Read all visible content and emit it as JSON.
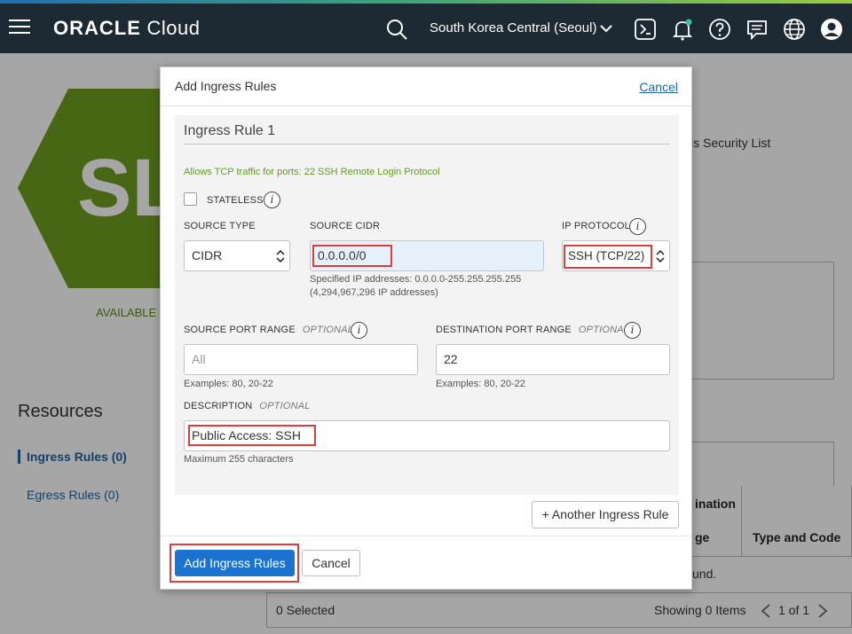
{
  "topbar": {
    "brand_bold": "ORACLE",
    "brand_light": "Cloud",
    "region": "South Korea Central (Seoul)",
    "icons": [
      "menu-icon",
      "search-icon",
      "chevron-down-icon",
      "cloud-shell-icon",
      "bell-icon",
      "help-icon",
      "chat-icon",
      "globe-icon",
      "user-icon"
    ],
    "accent_colors": [
      "#1f6fb4",
      "#3aa37c",
      "#9ccb3b"
    ]
  },
  "background": {
    "badge_text": "SL",
    "status": "AVAILABLE",
    "resources_title": "Resources",
    "resources_items": [
      {
        "label": "Ingress Rules (0)"
      },
      {
        "label": "Egress Rules (0)"
      }
    ],
    "partial_text_security_list": "is Security List",
    "table_headers": [
      "ination",
      "ge",
      "Type and Code"
    ],
    "partial_text_found": "und.",
    "selected": "0 Selected",
    "showing": "Showing 0 Items",
    "page": "1 of 1"
  },
  "modal": {
    "title": "Add Ingress Rules",
    "cancel_link": "Cancel",
    "rule_title": "Ingress Rule 1",
    "allows_text": "Allows TCP traffic for ports: 22 SSH Remote Login Protocol",
    "stateless_label": "STATELESS",
    "stateless_checked": false,
    "source_type_label": "SOURCE TYPE",
    "source_type_value": "CIDR",
    "source_cidr_label": "SOURCE CIDR",
    "source_cidr_value": "0.0.0.0/0",
    "source_cidr_hint_1": "Specified IP addresses: 0.0.0.0-255.255.255.255",
    "source_cidr_hint_2": "(4,294,967,296 IP addresses)",
    "ip_protocol_label": "IP PROTOCOL",
    "ip_protocol_value": "SSH (TCP/22)",
    "source_port_label": "SOURCE PORT RANGE",
    "optional": "OPTIONAL",
    "source_port_placeholder": "All",
    "source_port_hint": "Examples: 80, 20-22",
    "dest_port_label": "DESTINATION PORT RANGE",
    "dest_port_value": "22",
    "dest_port_hint": "Examples: 80, 20-22",
    "description_label": "DESCRIPTION",
    "description_value": "Public Access: SSH",
    "description_hint": "Maximum 255 characters",
    "another_rule_button": "+ Another Ingress Rule",
    "add_button": "Add Ingress Rules",
    "cancel_button": "Cancel"
  },
  "colors": {
    "primary": "#1a73d0",
    "link": "#1a66a6",
    "success_text": "#5f9e1f",
    "highlight": "#e03c3c",
    "topbar": "#1e2a33"
  }
}
